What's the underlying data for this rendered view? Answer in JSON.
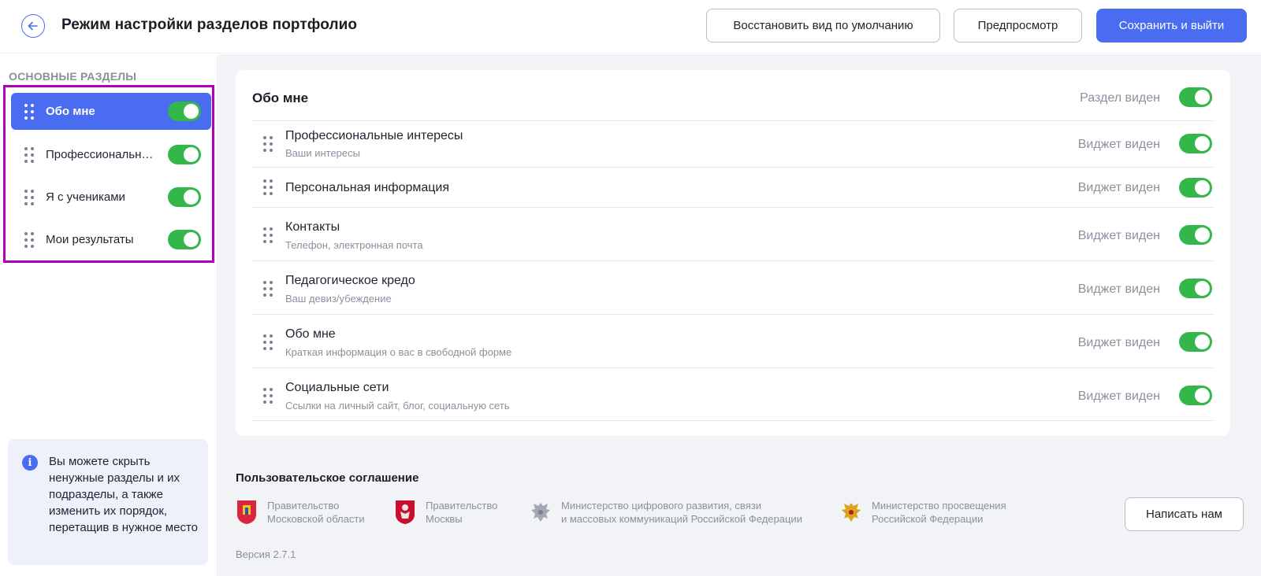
{
  "header": {
    "title": "Режим настройки разделов портфолио",
    "restore_label": "Восстановить вид по умолчанию",
    "preview_label": "Предпросмотр",
    "save_label": "Сохранить и выйти"
  },
  "sidebar": {
    "heading": "ОСНОВНЫЕ РАЗДЕЛЫ",
    "items": [
      {
        "label": "Обо мне",
        "active": true,
        "enabled": true
      },
      {
        "label": "Профессиональные интересы",
        "active": false,
        "enabled": true
      },
      {
        "label": "Я с учениками",
        "active": false,
        "enabled": true
      },
      {
        "label": "Мои результаты",
        "active": false,
        "enabled": true
      }
    ],
    "info_text": "Вы можете скрыть ненужные разделы и их подразделы, а также изменить их порядок, перетащив в нужное место"
  },
  "section": {
    "title": "Обо мне",
    "status": "Раздел виден",
    "enabled": true,
    "widgets": [
      {
        "title": "Профессиональные интересы",
        "subtitle": "Ваши интересы",
        "status": "Виджет виден",
        "enabled": true
      },
      {
        "title": "Персональная информация",
        "subtitle": "",
        "status": "Виджет виден",
        "enabled": true
      },
      {
        "title": "Контакты",
        "subtitle": "Телефон, электронная почта",
        "status": "Виджет виден",
        "enabled": true
      },
      {
        "title": "Педагогическое кредо",
        "subtitle": "Ваш девиз/убеждение",
        "status": "Виджет виден",
        "enabled": true
      },
      {
        "title": "Обо мне",
        "subtitle": "Краткая информация о вас в свободной форме",
        "status": "Виджет виден",
        "enabled": true
      },
      {
        "title": "Социальные сети",
        "subtitle": "Ссылки на личный сайт, блог, социальную сеть",
        "status": "Виджет виден",
        "enabled": true
      }
    ]
  },
  "footer": {
    "agreement": "Пользовательское соглашение",
    "orgs": [
      {
        "line1": "Правительство",
        "line2": "Московской области",
        "icon": "moscow-oblast-emblem-icon"
      },
      {
        "line1": "Правительство",
        "line2": "Москвы",
        "icon": "moscow-emblem-icon"
      },
      {
        "line1": "Министерство цифрового развития, связи",
        "line2": "и массовых коммуникаций Российской Федерации",
        "icon": "russia-eagle-gray-icon"
      },
      {
        "line1": "Министерство просвещения",
        "line2": "Российской Федерации",
        "icon": "russia-eagle-gold-icon"
      }
    ],
    "contact_label": "Написать нам",
    "version": "Версия 2.7.1"
  },
  "colors": {
    "accent": "#4a6cf0",
    "toggle_on": "#33b74a",
    "highlight_border": "#b000b5"
  }
}
